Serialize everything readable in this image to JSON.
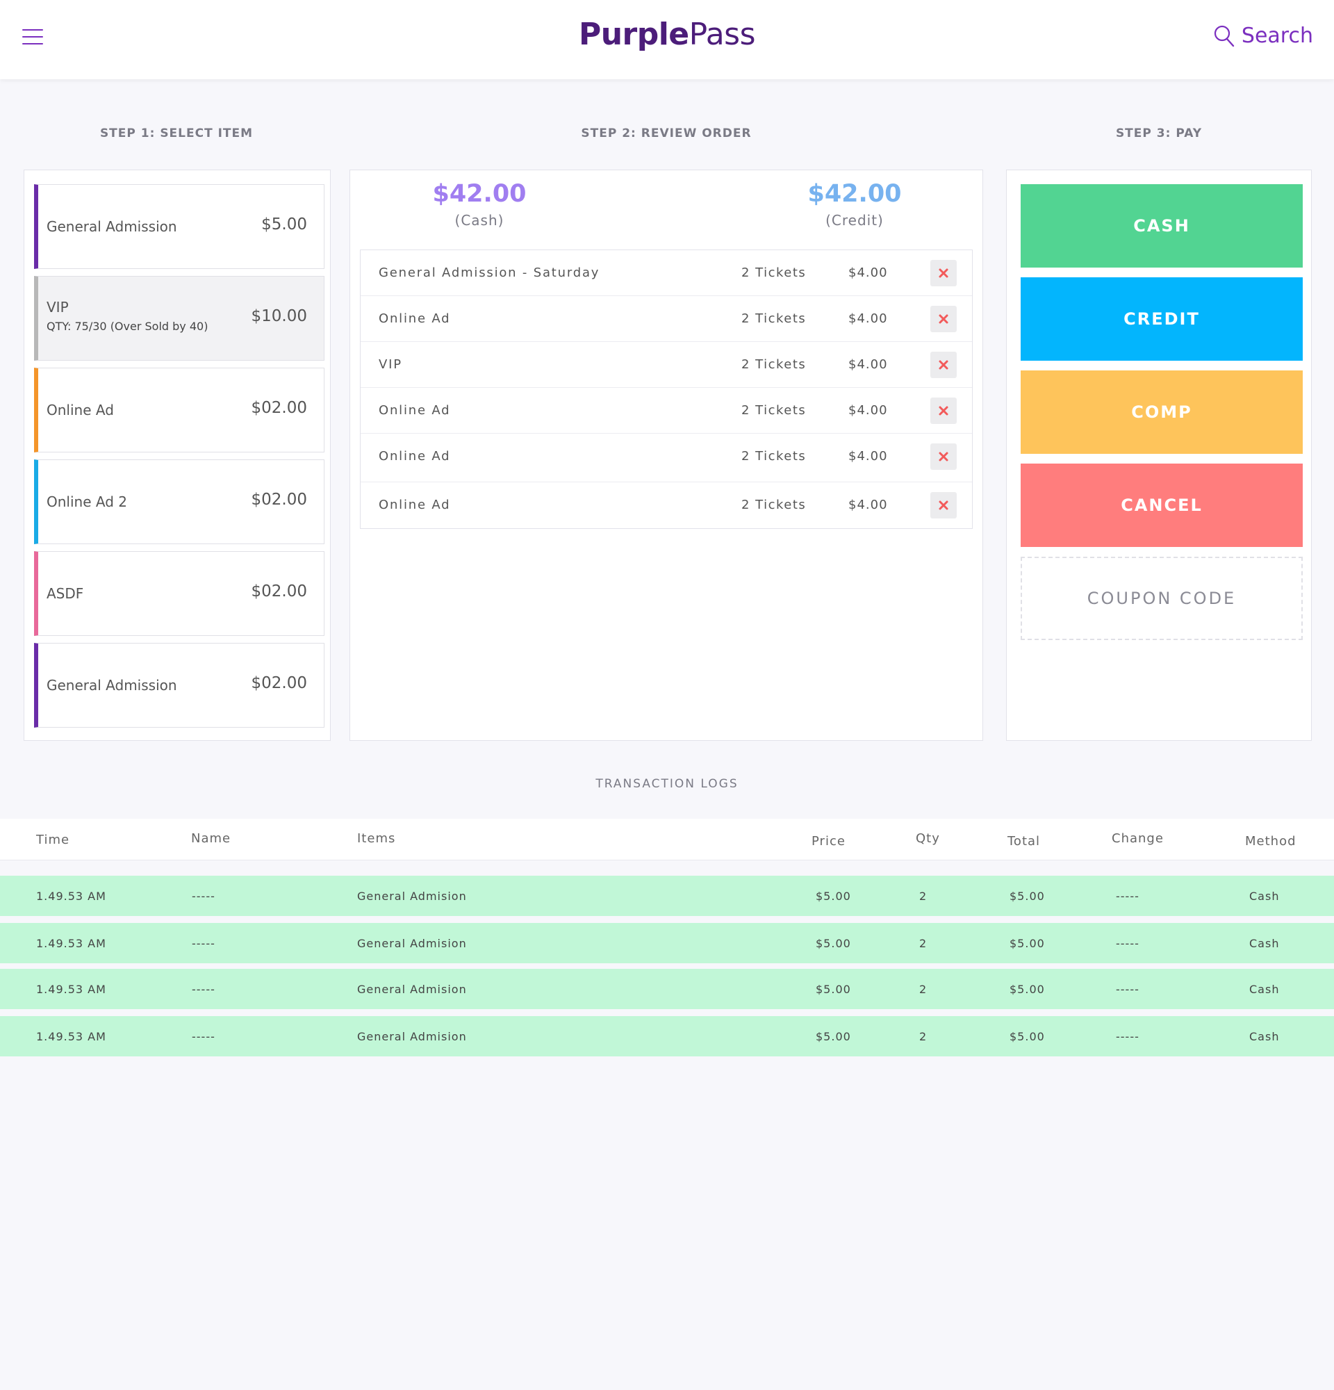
{
  "header": {
    "logo_bold": "Purple",
    "logo_light": "Pass",
    "search_label": "Search"
  },
  "steps": {
    "step1_title": "STEP 1: SELECT ITEM",
    "step2_title": "STEP 2: REVIEW ORDER",
    "step3_title": "STEP 3: PAY"
  },
  "items": [
    {
      "name": "General Admission",
      "sub": "",
      "price": "$5.00",
      "accent": "#6a2ca8"
    },
    {
      "name": "VIP",
      "sub": "QTY: 75/30 (Over Sold by 40)",
      "price": "$10.00",
      "accent": "#b8b8b8"
    },
    {
      "name": "Online Ad",
      "sub": "",
      "price": "$02.00",
      "accent": "#f4952a"
    },
    {
      "name": "Online Ad 2",
      "sub": "",
      "price": "$02.00",
      "accent": "#1aabe6"
    },
    {
      "name": "ASDF",
      "sub": "",
      "price": "$02.00",
      "accent": "#e8699a"
    },
    {
      "name": "General Admission",
      "sub": "",
      "price": "$02.00",
      "accent": "#6a2ca8"
    }
  ],
  "totals": {
    "cash_amount": "$42.00",
    "cash_label": "(Cash)",
    "cash_color": "#a07ef0",
    "credit_amount": "$42.00",
    "credit_label": "(Credit)",
    "credit_color": "#77b2ef"
  },
  "order": [
    {
      "name": "General Admission - Saturday",
      "qty": "2 Tickets",
      "price": "$4.00"
    },
    {
      "name": "Online Ad",
      "qty": "2 Tickets",
      "price": "$4.00"
    },
    {
      "name": "VIP",
      "qty": "2 Tickets",
      "price": "$4.00"
    },
    {
      "name": "Online Ad",
      "qty": "2 Tickets",
      "price": "$4.00"
    },
    {
      "name": "Online Ad",
      "qty": "2 Tickets",
      "price": "$4.00"
    },
    {
      "name": "Online Ad",
      "qty": "2 Tickets",
      "price": "$4.00"
    }
  ],
  "pay": {
    "cash": "CASH",
    "credit": "CREDIT",
    "comp": "COMP",
    "cancel": "CANCEL",
    "coupon_placeholder": "COUPON CODE",
    "colors": {
      "cash": "#52d492",
      "credit": "#03b5fd",
      "comp": "#fec45b",
      "cancel": "#ff7d7d"
    }
  },
  "logs": {
    "title": "TRANSACTION LOGS",
    "columns": {
      "time": "Time",
      "name": "Name",
      "items": "Items",
      "price": "Price",
      "qty": "Qty",
      "total": "Total",
      "change": "Change",
      "method": "Method"
    },
    "rows": [
      {
        "time": "1.49.53 AM",
        "name": "-----",
        "items": "General Admision",
        "price": "$5.00",
        "qty": "2",
        "total": "$5.00",
        "change": "-----",
        "method": "Cash"
      },
      {
        "time": "1.49.53 AM",
        "name": "-----",
        "items": "General Admision",
        "price": "$5.00",
        "qty": "2",
        "total": "$5.00",
        "change": "-----",
        "method": "Cash"
      },
      {
        "time": "1.49.53 AM",
        "name": "-----",
        "items": "General Admision",
        "price": "$5.00",
        "qty": "2",
        "total": "$5.00",
        "change": "-----",
        "method": "Cash"
      },
      {
        "time": "1.49.53 AM",
        "name": "-----",
        "items": "General Admision",
        "price": "$5.00",
        "qty": "2",
        "total": "$5.00",
        "change": "-----",
        "method": "Cash"
      }
    ]
  }
}
